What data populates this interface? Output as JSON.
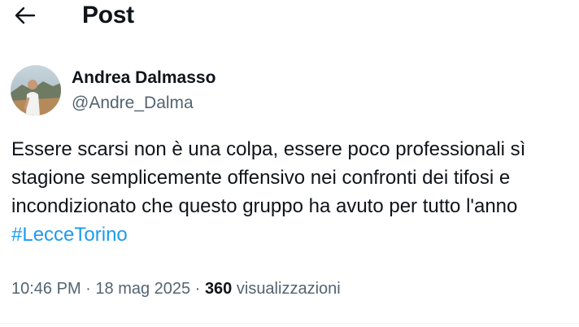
{
  "header": {
    "title": "Post",
    "back_icon": "arrow-left-icon"
  },
  "author": {
    "display_name": "Andrea Dalmasso",
    "handle": "@Andre_Dalma",
    "avatar_icon": "profile-photo"
  },
  "tweet": {
    "lines": [
      "Essere scarsi non è una colpa, essere poco professionali sì",
      "stagione semplicemente offensivo nei confronti dei tifosi e",
      "incondizionato che questo gruppo ha avuto per tutto l'anno"
    ],
    "hashtag": "#LecceTorino"
  },
  "meta": {
    "time": "10:46 PM",
    "separator1": " · ",
    "date": "18 mag 2025",
    "separator2": " · ",
    "views_count": "360",
    "views_label": " visualizzazioni"
  },
  "colors": {
    "text": "#0f1419",
    "secondary": "#536471",
    "link": "#1d9bf0"
  }
}
